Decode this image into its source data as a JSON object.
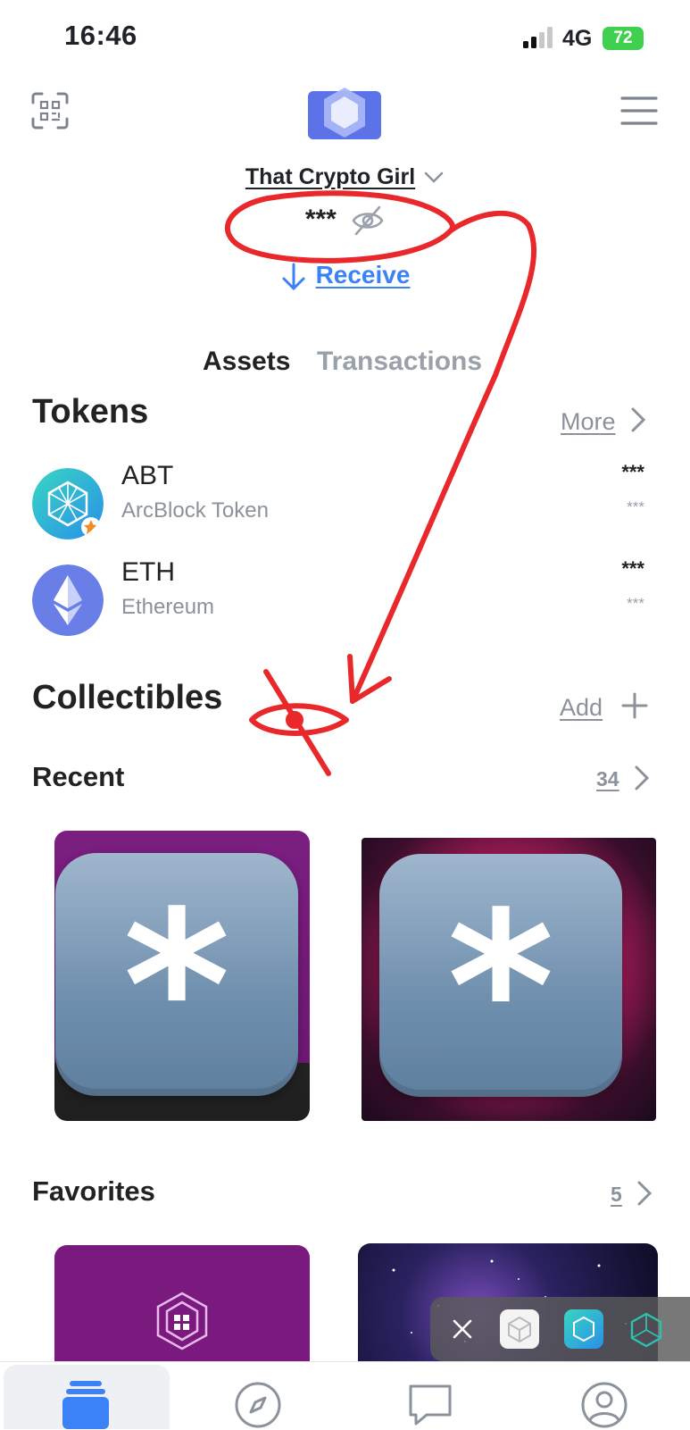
{
  "status_bar": {
    "time": "16:46",
    "network": "4G",
    "battery": "72"
  },
  "header": {
    "wallet_name": "That Crypto Girl",
    "balance": "***",
    "receive_label": "Receive"
  },
  "tabs": [
    {
      "label": "Assets",
      "active": true
    },
    {
      "label": "Transactions",
      "active": false
    }
  ],
  "tokens": {
    "title": "Tokens",
    "more_label": "More",
    "items": [
      {
        "symbol": "ABT",
        "name": "ArcBlock Token",
        "balance": "***",
        "value": "***"
      },
      {
        "symbol": "ETH",
        "name": "Ethereum",
        "balance": "***",
        "value": "***"
      }
    ]
  },
  "collectibles": {
    "title": "Collectibles",
    "add_label": "Add",
    "recent": {
      "title": "Recent",
      "count": "34"
    },
    "favorites": {
      "title": "Favorites",
      "count": "5"
    }
  },
  "bottom_nav": {
    "items": [
      {
        "icon": "wallet-icon",
        "active": true
      },
      {
        "icon": "compass-icon",
        "active": false
      },
      {
        "icon": "chat-icon",
        "active": false
      },
      {
        "icon": "profile-icon",
        "active": false
      }
    ]
  },
  "colors": {
    "accent": "#3b82f6",
    "annotation": "#e8282b",
    "purple_card": "#7a1a7e",
    "battery": "#3fd04f"
  }
}
